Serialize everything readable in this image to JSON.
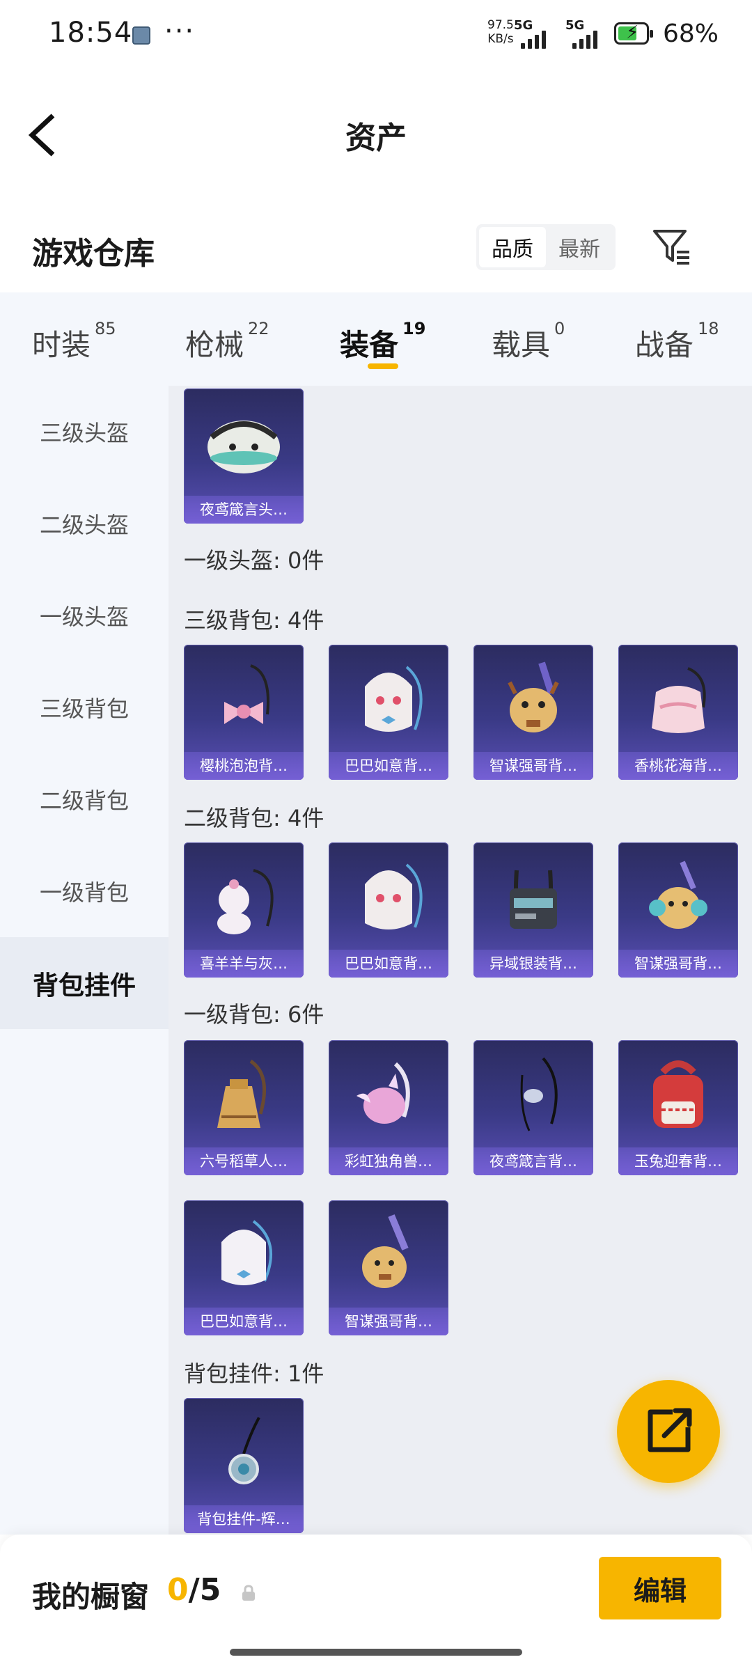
{
  "status_bar": {
    "time": "18:54",
    "more": "···",
    "net_speed_value": "97.5",
    "net_speed_unit": "KB/s",
    "sim1_label": "5G",
    "sim2_label": "5G",
    "battery_percent": "68%",
    "battery_level": 0.68,
    "colors": {
      "battery_fill": "#3ec24b"
    }
  },
  "header": {
    "title": "资产",
    "back_icon": "chevron-left-icon"
  },
  "warehouse": {
    "title": "游戏仓库",
    "sort_options": [
      "品质",
      "最新"
    ],
    "sort_selected": "品质",
    "filter_icon": "filter-icon"
  },
  "tabs": [
    {
      "label": "时装",
      "count": "85"
    },
    {
      "label": "枪械",
      "count": "22"
    },
    {
      "label": "装备",
      "count": "19",
      "active": true
    },
    {
      "label": "载具",
      "count": "0"
    },
    {
      "label": "战备",
      "count": "18"
    }
  ],
  "sidebar": {
    "items": [
      "三级头盔",
      "二级头盔",
      "一级头盔",
      "三级背包",
      "二级背包",
      "一级背包",
      "背包挂件"
    ],
    "active": "背包挂件"
  },
  "content": {
    "groups": [
      {
        "label": "",
        "items": [
          "夜鸢箴言头…"
        ]
      },
      {
        "label": "一级头盔: 0件",
        "items": []
      },
      {
        "label": "三级背包: 4件",
        "items": [
          "樱桃泡泡背…",
          "巴巴如意背…",
          "智谋强哥背…",
          "香桃花海背…"
        ]
      },
      {
        "label": "二级背包: 4件",
        "items": [
          "喜羊羊与灰…",
          "巴巴如意背…",
          "异域银装背…",
          "智谋强哥背…"
        ]
      },
      {
        "label": "一级背包: 6件",
        "items": [
          "六号稻草人…",
          "彩虹独角兽…",
          "夜鸢箴言背…",
          "玉兔迎春背…",
          "巴巴如意背…",
          "智谋强哥背…"
        ]
      },
      {
        "label": "背包挂件: 1件",
        "items": [
          "背包挂件-辉…"
        ]
      }
    ]
  },
  "fab": {
    "icon": "share-external-icon"
  },
  "bottom_bar": {
    "window_label": "我的橱窗",
    "window_current": "0",
    "window_total": "/5",
    "lock_icon": "lock-icon",
    "edit_label": "编辑"
  },
  "colors": {
    "accent": "#f7b500",
    "card_bg": "#3a3a86",
    "sidebar_bg": "#f4f7fc",
    "content_bg": "#eceef3"
  }
}
